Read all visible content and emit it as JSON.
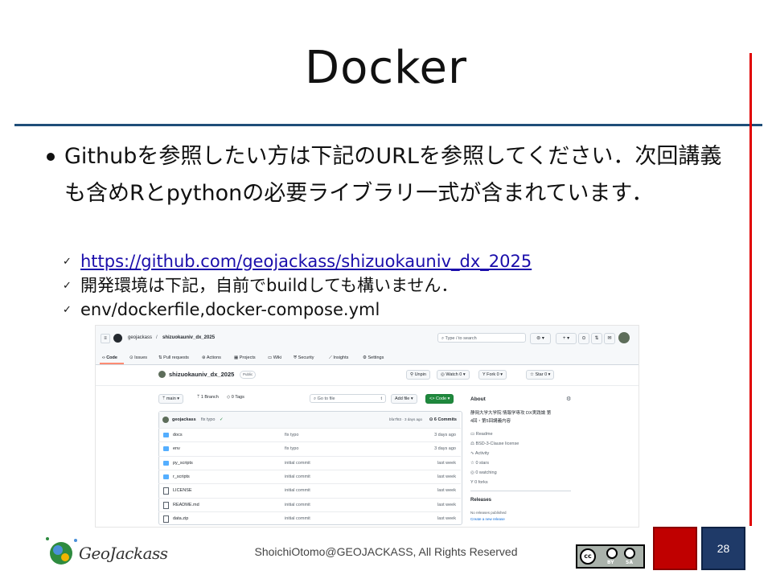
{
  "slide": {
    "title": "Docker",
    "bullet": "Githubを参照したい方は下記のURLを参照してください．次回講義も含めRとpythonの必要ライブラリ一式が含まれています．",
    "subs": [
      "https://github.com/geojackass/shizuokauniv_dx_2025",
      "開発環境は下記，自前でbuildしても構いません．",
      "env/dockerfile,docker-compose.yml"
    ],
    "check_glyph": "✓"
  },
  "github": {
    "owner": "geojackass",
    "sep": "/",
    "repo": "shizuokauniv_dx_2025",
    "search": "Type / to search",
    "nav": [
      "Code",
      "Issues",
      "Pull requests",
      "Actions",
      "Projects",
      "Wiki",
      "Security",
      "Insights",
      "Settings"
    ],
    "repo_title": "shizuokauniv_dx_2025",
    "visibility": "Public",
    "unpin": "Unpin",
    "watch": "Watch",
    "watch_count": "0",
    "fork": "Fork",
    "fork_count": "0",
    "star": "Star",
    "star_count": "0",
    "branch_select": "main",
    "branches": "1 Branch",
    "tags": "0 Tags",
    "goto": "Go to file",
    "goto_key": "t",
    "add_file": "Add file",
    "code_btn": "<> Code",
    "commit_user": "geojackass",
    "commit_msg": "fix typo",
    "commit_meta": "bfa7f83 · 3 days ago",
    "commits": "6 Commits",
    "files": [
      {
        "name": "docs",
        "commit": "fix typo",
        "time": "3 days ago",
        "type": "dir"
      },
      {
        "name": "env",
        "commit": "fix typo",
        "time": "3 days ago",
        "type": "dir"
      },
      {
        "name": "py_scripts",
        "commit": "initial commit",
        "time": "last week",
        "type": "dir"
      },
      {
        "name": "r_scripts",
        "commit": "initial commit",
        "time": "last week",
        "type": "dir"
      },
      {
        "name": "LICENSE",
        "commit": "initial commit",
        "time": "last week",
        "type": "file"
      },
      {
        "name": "README.md",
        "commit": "initial commit",
        "time": "last week",
        "type": "file"
      },
      {
        "name": "data.zip",
        "commit": "initial commit",
        "time": "last week",
        "type": "file"
      }
    ],
    "about_title": "About",
    "about_desc1": "静岡大学大学院 情報学専攻 DX実践論 第",
    "about_desc2": "4回・第5回講義内容",
    "about_items": [
      "Readme",
      "BSD-3-Clause license",
      "Activity",
      "0 stars",
      "0 watching",
      "0 forks"
    ],
    "releases_title": "Releases",
    "releases_none": "No releases published",
    "releases_link": "Create a new release"
  },
  "footer": {
    "logo_text": "GeoJackass",
    "copyright": "ShoichiOtomo@GEOJACKASS, All Rights Reserved",
    "cc_by": "BY",
    "cc_sa": "SA",
    "page_number": "28"
  }
}
